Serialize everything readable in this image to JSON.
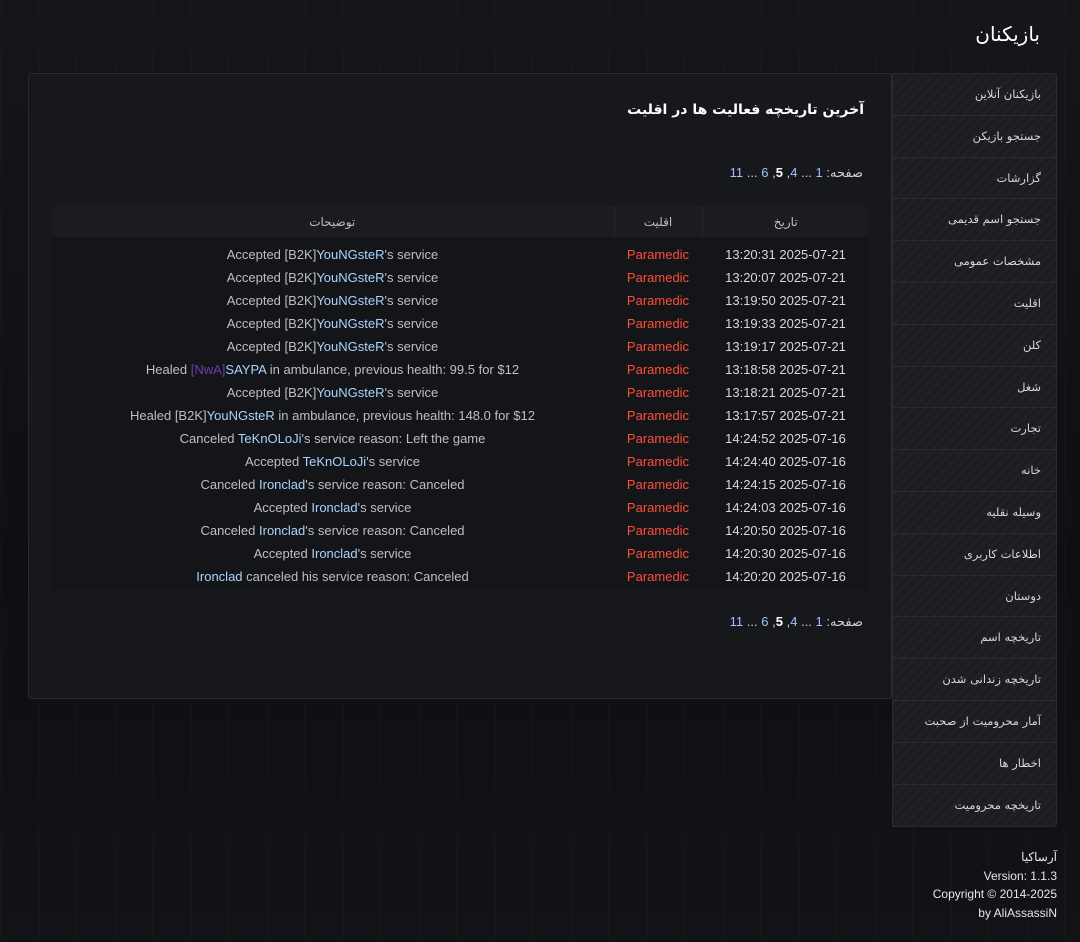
{
  "page_title": "بازیکنان",
  "panel": {
    "heading": "آخرین تاریخچه فعالیت ها در اقلیت",
    "pagination": {
      "label": "صفحه:",
      "pages": [
        "1",
        "...",
        "4",
        "5",
        "6",
        "...",
        "11"
      ],
      "current": "5"
    }
  },
  "table": {
    "headers": {
      "date": "تاریخ",
      "faction": "اقلیت",
      "description": "توضیحات"
    },
    "rows": [
      {
        "date": "2025-07-21 13:20:31",
        "faction": "Paramedic",
        "parts": [
          {
            "t": "Accepted [B2K]"
          },
          {
            "t": "YouNGsteR",
            "c": "name"
          },
          {
            "t": "'s service"
          }
        ]
      },
      {
        "date": "2025-07-21 13:20:07",
        "faction": "Paramedic",
        "parts": [
          {
            "t": "Accepted [B2K]"
          },
          {
            "t": "YouNGsteR",
            "c": "name"
          },
          {
            "t": "'s service"
          }
        ]
      },
      {
        "date": "2025-07-21 13:19:50",
        "faction": "Paramedic",
        "parts": [
          {
            "t": "Accepted [B2K]"
          },
          {
            "t": "YouNGsteR",
            "c": "name"
          },
          {
            "t": "'s service"
          }
        ]
      },
      {
        "date": "2025-07-21 13:19:33",
        "faction": "Paramedic",
        "parts": [
          {
            "t": "Accepted [B2K]"
          },
          {
            "t": "YouNGsteR",
            "c": "name"
          },
          {
            "t": "'s service"
          }
        ]
      },
      {
        "date": "2025-07-21 13:19:17",
        "faction": "Paramedic",
        "parts": [
          {
            "t": "Accepted [B2K]"
          },
          {
            "t": "YouNGsteR",
            "c": "name"
          },
          {
            "t": "'s service"
          }
        ]
      },
      {
        "date": "2025-07-21 13:18:58",
        "faction": "Paramedic",
        "parts": [
          {
            "t": "Healed "
          },
          {
            "t": "[NwA]",
            "c": "tag-nwa"
          },
          {
            "t": "SAYPA",
            "c": "name"
          },
          {
            "t": " in ambulance, previous health: 99.5 for $12"
          }
        ]
      },
      {
        "date": "2025-07-21 13:18:21",
        "faction": "Paramedic",
        "parts": [
          {
            "t": "Accepted [B2K]"
          },
          {
            "t": "YouNGsteR",
            "c": "name"
          },
          {
            "t": "'s service"
          }
        ]
      },
      {
        "date": "2025-07-21 13:17:57",
        "faction": "Paramedic",
        "parts": [
          {
            "t": "Healed [B2K]"
          },
          {
            "t": "YouNGsteR",
            "c": "name"
          },
          {
            "t": " in ambulance, previous health: 148.0 for $12"
          }
        ]
      },
      {
        "date": "2025-07-16 14:24:52",
        "faction": "Paramedic",
        "parts": [
          {
            "t": "Canceled "
          },
          {
            "t": "TeKnOLoJi",
            "c": "name"
          },
          {
            "t": "'s service reason: Left the game"
          }
        ]
      },
      {
        "date": "2025-07-16 14:24:40",
        "faction": "Paramedic",
        "parts": [
          {
            "t": "Accepted "
          },
          {
            "t": "TeKnOLoJi",
            "c": "name"
          },
          {
            "t": "'s service"
          }
        ]
      },
      {
        "date": "2025-07-16 14:24:15",
        "faction": "Paramedic",
        "parts": [
          {
            "t": "Canceled "
          },
          {
            "t": "Ironclad",
            "c": "name"
          },
          {
            "t": "'s service reason: Canceled"
          }
        ]
      },
      {
        "date": "2025-07-16 14:24:03",
        "faction": "Paramedic",
        "parts": [
          {
            "t": "Accepted "
          },
          {
            "t": "Ironclad",
            "c": "name"
          },
          {
            "t": "'s service"
          }
        ]
      },
      {
        "date": "2025-07-16 14:20:50",
        "faction": "Paramedic",
        "parts": [
          {
            "t": "Canceled "
          },
          {
            "t": "Ironclad",
            "c": "name"
          },
          {
            "t": "'s service reason: Canceled"
          }
        ]
      },
      {
        "date": "2025-07-16 14:20:30",
        "faction": "Paramedic",
        "parts": [
          {
            "t": "Accepted "
          },
          {
            "t": "Ironclad",
            "c": "name"
          },
          {
            "t": "'s service"
          }
        ]
      },
      {
        "date": "2025-07-16 14:20:20",
        "faction": "Paramedic",
        "parts": [
          {
            "t": "Ironclad",
            "c": "name"
          },
          {
            "t": " canceled his service reason: Canceled"
          }
        ]
      }
    ]
  },
  "sidebar": {
    "items": [
      "بازیکنان آنلاین",
      "جستجو بازیکن",
      "گزارشات",
      "جستجو اسم قدیمی",
      "مشخصات عمومی",
      "اقلیت",
      "کلن",
      "شغل",
      "تجارت",
      "خانه",
      "وسیله نقلیه",
      "اطلاعات کاربری",
      "دوستان",
      "تاریخچه اسم",
      "تاریخچه زندانی شدن",
      "آمار محرومیت از صحبت",
      "اخطار ها",
      "تاریخچه محرومیت"
    ]
  },
  "footer": {
    "brand": "آرساکیا",
    "version": "Version: 1.1.3",
    "copyright": "Copyright © 2014-2025",
    "author": "by AliAssassiN"
  },
  "colors": {
    "faction": "#ff4d3a",
    "player_name": "#a8d4ff",
    "tag_nwa": "#6b3fa8",
    "page_link": "#9ec2ff"
  }
}
